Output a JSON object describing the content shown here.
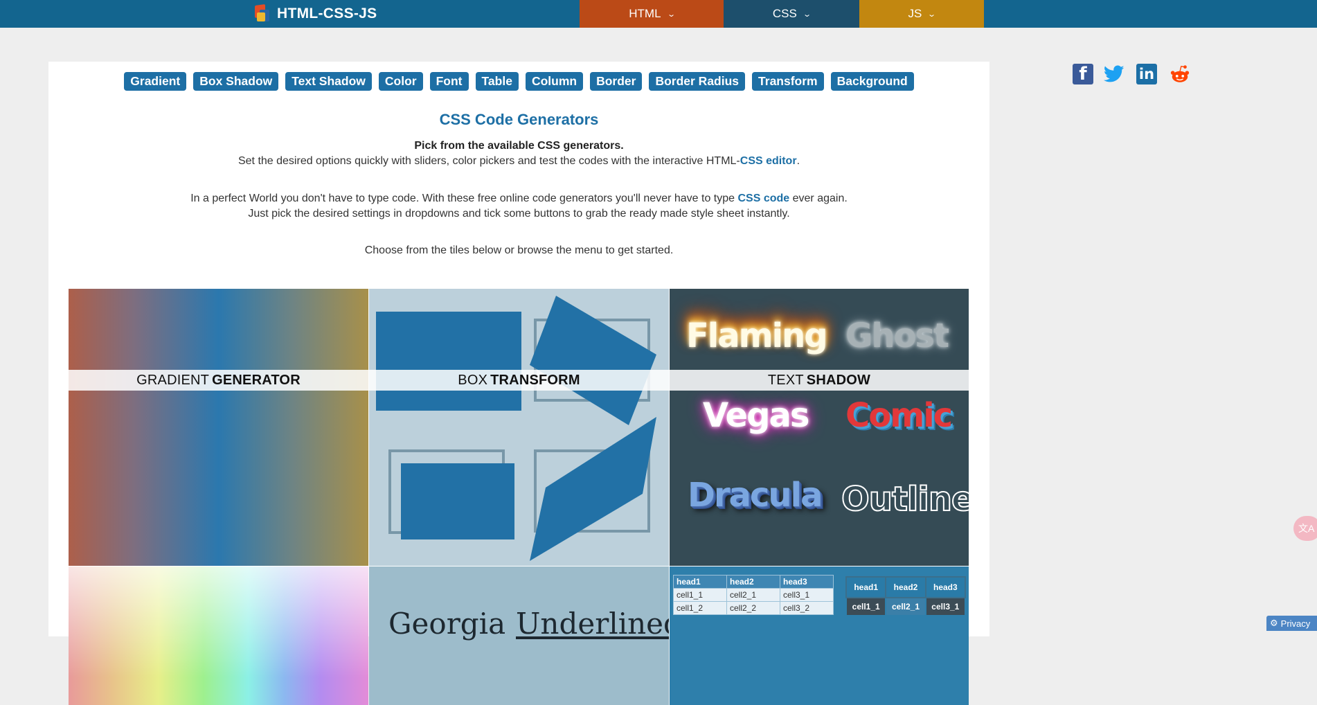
{
  "nav": {
    "brand": "HTML-CSS-JS",
    "tabs": [
      {
        "label": "HTML",
        "color": "#bb4a17"
      },
      {
        "label": "CSS",
        "color": "#1d4f6c"
      },
      {
        "label": "JS",
        "color": "#c28710"
      }
    ]
  },
  "chips": [
    "Gradient",
    "Box Shadow",
    "Text Shadow",
    "Color",
    "Font",
    "Table",
    "Column",
    "Border",
    "Border Radius",
    "Transform",
    "Background"
  ],
  "page": {
    "title": "CSS Code Generators",
    "p1_bold": "Pick from the available CSS generators.",
    "p1_text": "Set the desired options quickly with sliders, color pickers and test the codes with the interactive HTML-",
    "p1_link": "CSS editor",
    "p1_end": ".",
    "p2_text_a": "In a perfect World you don't have to type code. With these free online code generators you'll never have to type ",
    "p2_link": "CSS code",
    "p2_text_b": " ever again.",
    "p2_line2": "Just pick the desired settings in dropdowns and tick some buttons to grab the ready made style sheet instantly.",
    "p3": "Choose from the tiles below or browse the menu to get started."
  },
  "tiles": {
    "gradient": {
      "light": "GRADIENT",
      "bold": "GENERATOR"
    },
    "box": {
      "light": "BOX",
      "bold": "TRANSFORM"
    },
    "text": {
      "light": "TEXT",
      "bold": "SHADOW"
    },
    "text_samples": [
      "Flaming",
      "Ghost",
      "Vegas",
      "Comic",
      "Dracula",
      "Outline"
    ],
    "font_samples": [
      "Georgia",
      "Underlined"
    ],
    "table1": {
      "headers": [
        "head1",
        "head2",
        "head3"
      ],
      "rows": [
        [
          "cell1_1",
          "cell2_1",
          "cell3_1"
        ],
        [
          "cell1_2",
          "cell2_2",
          "cell3_2"
        ]
      ]
    },
    "table2": {
      "headers": [
        "head1",
        "head2",
        "head3"
      ],
      "rows": [
        [
          "cell1_1",
          "cell2_1",
          "cell3_1"
        ]
      ]
    }
  },
  "social": {
    "facebook": "facebook-icon",
    "twitter": "twitter-icon",
    "linkedin": "linkedin-icon",
    "reddit": "reddit-icon"
  },
  "misc": {
    "privacy": "Privacy",
    "accent": "#1d6fa5"
  }
}
